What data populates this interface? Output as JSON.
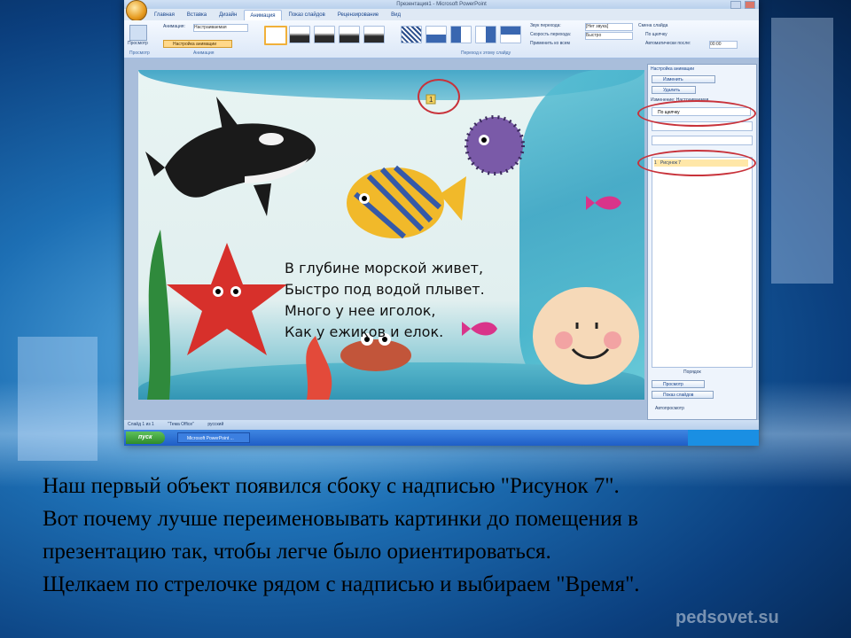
{
  "window": {
    "title": "Презентация1 - Microsoft PowerPoint"
  },
  "ribbon": {
    "tabs": [
      "Главная",
      "Вставка",
      "Дизайн",
      "Анимация",
      "Показ слайдов",
      "Рецензирование",
      "Вид"
    ],
    "active_tab": "Анимация",
    "preview_label": "Просмотр",
    "animation_label": "Анимация:",
    "animation_value": "Настраиваемая",
    "custom_animation_button": "Настройка анимации",
    "group_preview": "Просмотр",
    "group_animation": "Анимация",
    "group_transition": "Переход к этому слайду",
    "transition_sound_label": "Звук перехода:",
    "transition_sound_value": "[Нет звука]",
    "transition_speed_label": "Скорость перехода:",
    "transition_speed_value": "Быстро",
    "apply_all_label": "Применить ко всем",
    "advance_label": "Смена слайда",
    "on_click_label": "По щелчку",
    "auto_after_label": "Автоматически после:",
    "auto_after_value": "00:00"
  },
  "slide": {
    "poem": [
      "В глубине морской живет,",
      "Быстро под водой плывет.",
      "Много у нее иголок,",
      "Как у ежиков и елок."
    ],
    "badge": "1"
  },
  "task_pane": {
    "title": "Настройка анимации",
    "change_button": "Изменить",
    "delete_button": "Удалить",
    "change_header": "Изменение: Настраиваемая",
    "start_select": "По щелчку",
    "list_item_number": "1",
    "list_item_label": "Рисунок 7",
    "reorder_label": "Порядок",
    "preview_button": "Просмотр",
    "slideshow_button": "Показ слайдов",
    "autopreview_label": "Автопросмотр"
  },
  "statusbar": {
    "slide_info": "Слайд 1 из 1",
    "theme": "\"Тема Office\"",
    "language": "русский"
  },
  "taskbar": {
    "start_label": "пуск",
    "task_item": "Microsoft PowerPoint ..."
  },
  "caption": {
    "lines": [
      "Наш первый объект появился сбоку с надписью \"Рисунок 7\".",
      "Вот почему лучше  переименовывать картинки до помещения в",
      "презентацию так, чтобы легче было ориентироваться.",
      "Щелкаем по стрелочке рядом с надписью и выбираем \"Время\"."
    ]
  },
  "watermark": "pedsovet.su",
  "colors": {
    "background_blue": "#1d6fb4",
    "highlight_circle": "#c8323a",
    "office_accent": "#15428b"
  }
}
